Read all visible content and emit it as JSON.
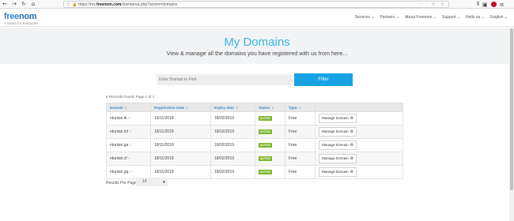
{
  "browser": {
    "back_icon": "back-arrow-icon",
    "forward_icon": "forward-arrow-icon",
    "reload_icon": "reload-icon",
    "home_icon": "home-icon",
    "url_prefix": "https://my.",
    "url_domain": "freenom.com",
    "url_rest": "/clientarea.php?action=domains",
    "url_actions": "··· ☆ ☆"
  },
  "site": {
    "logo_free": "free",
    "logo_nom": "nom",
    "tagline": "A Name for Everyone",
    "nav": [
      "Services ⌄",
      "Partners ⌄",
      "About Freenom ⌄",
      "Support ⌄",
      "Hello nu ⌄",
      "English ⌄"
    ]
  },
  "hero": {
    "title": "My Domains",
    "subtitle": "View & manage all the domains you have registered with us from here..."
  },
  "filter": {
    "placeholder": "Enter Domain to Find",
    "button_label": "Filter"
  },
  "records_info": "5 Records Found, Page 1 of 1",
  "table": {
    "headers": [
      "Domain",
      "Registration Date",
      "Expiry date",
      "Status",
      "Type",
      ""
    ],
    "rows": [
      {
        "domain": "ntunian.tk",
        "reg": "18/11/2018",
        "exp": "18/02/2019",
        "status": "ACTIVE",
        "type": "Free",
        "action": "Manage Domain"
      },
      {
        "domain": "ntunian.ml",
        "reg": "18/11/2018",
        "exp": "18/02/2019",
        "status": "ACTIVE",
        "type": "Free",
        "action": "Manage Domain"
      },
      {
        "domain": "ntunian.ga",
        "reg": "18/11/2018",
        "exp": "18/02/2019",
        "status": "ACTIVE",
        "type": "Free",
        "action": "Manage Domain"
      },
      {
        "domain": "ntunian.cf",
        "reg": "18/11/2018",
        "exp": "18/02/2019",
        "status": "ACTIVE",
        "type": "Free",
        "action": "Manage Domain"
      },
      {
        "domain": "ntunian.gq",
        "reg": "18/11/2018",
        "exp": "18/02/2019",
        "status": "ACTIVE",
        "type": "Free",
        "action": "Manage Domain"
      }
    ]
  },
  "results_per_page": {
    "label": "Results Per Page",
    "value": "10"
  },
  "colors": {
    "accent": "#3bb3e4",
    "button": "#17a2e4",
    "status_active": "#7cb82f"
  }
}
